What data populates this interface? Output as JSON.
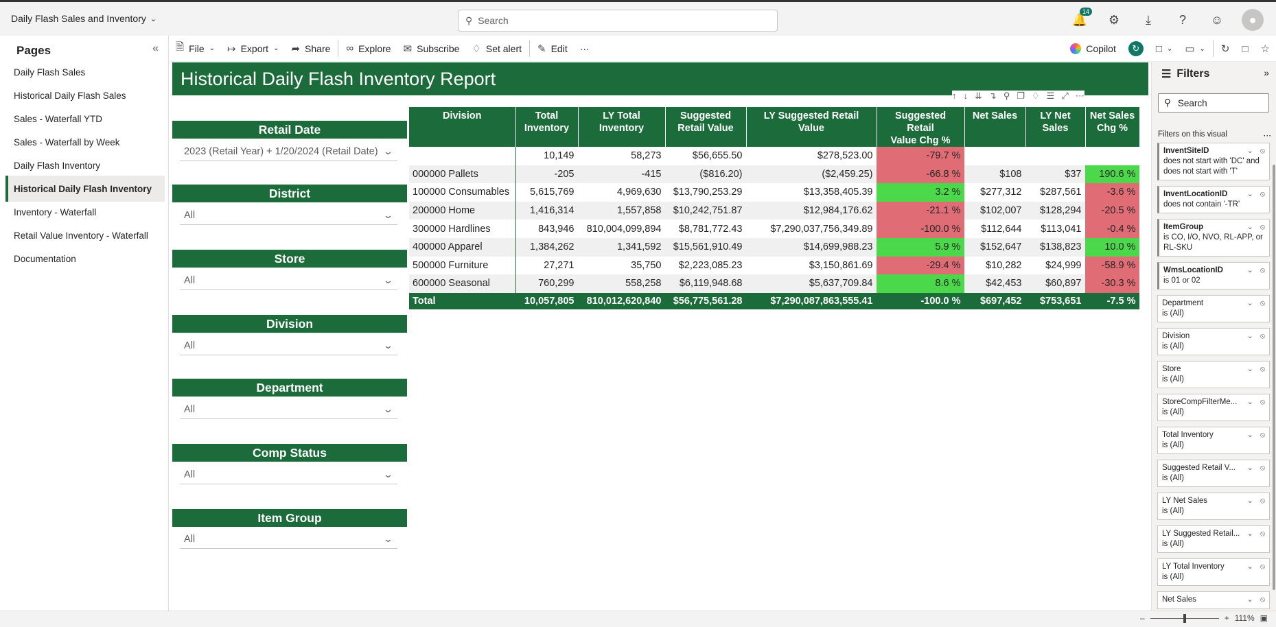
{
  "app": {
    "title": "Daily Flash Sales and Inventory",
    "search_placeholder": "Search",
    "notifications": "14"
  },
  "pages": {
    "heading": "Pages",
    "items": [
      {
        "label": "Daily Flash Sales"
      },
      {
        "label": "Historical Daily Flash Sales"
      },
      {
        "label": "Sales - Waterfall YTD"
      },
      {
        "label": "Sales - Waterfall by Week"
      },
      {
        "label": "Daily Flash Inventory"
      },
      {
        "label": "Historical Daily Flash Inventory"
      },
      {
        "label": "Inventory - Waterfall"
      },
      {
        "label": "Retail Value Inventory - Waterfall"
      },
      {
        "label": "Documentation"
      }
    ],
    "active_index": 5
  },
  "toolbar": {
    "file": "File",
    "export": "Export",
    "share": "Share",
    "explore": "Explore",
    "subscribe": "Subscribe",
    "set_alert": "Set alert",
    "edit": "Edit",
    "more": "···",
    "copilot": "Copilot"
  },
  "report": {
    "title": "Historical Daily Flash Inventory Report"
  },
  "slicers": [
    {
      "label": "Retail Date",
      "value": "2023 (Retail Year) + 1/20/2024 (Retail Date)"
    },
    {
      "label": "District",
      "value": "All"
    },
    {
      "label": "Store",
      "value": "All"
    },
    {
      "label": "Division",
      "value": "All"
    },
    {
      "label": "Department",
      "value": "All"
    },
    {
      "label": "Comp Status",
      "value": "All"
    },
    {
      "label": "Item Group",
      "value": "All"
    }
  ],
  "table": {
    "headers": [
      "Division",
      "Total\nInventory",
      "LY Total\nInventory",
      "Suggested\nRetail Value",
      "LY Suggested Retail Value",
      "Suggested Retail\nValue Chg %",
      "Net Sales",
      "LY Net\nSales",
      "Net Sales\nChg %"
    ],
    "rows": [
      [
        "",
        "10,149",
        "58,273",
        "$56,655.50",
        "$278,523.00",
        "-79.7 %",
        "",
        "",
        ""
      ],
      [
        "000000 Pallets",
        "-205",
        "-415",
        "($816.20)",
        "($2,459.25)",
        "-66.8 %",
        "$108",
        "$37",
        "190.6 %"
      ],
      [
        "100000 Consumables",
        "5,615,769",
        "4,969,630",
        "$13,790,253.29",
        "$13,358,405.39",
        "3.2 %",
        "$277,312",
        "$287,561",
        "-3.6 %"
      ],
      [
        "200000 Home",
        "1,416,314",
        "1,557,858",
        "$10,242,751.87",
        "$12,984,176.62",
        "-21.1 %",
        "$102,007",
        "$128,294",
        "-20.5 %"
      ],
      [
        "300000 Hardlines",
        "843,946",
        "810,004,099,894",
        "$8,781,772.43",
        "$7,290,037,756,349.89",
        "-100.0 %",
        "$112,644",
        "$113,041",
        "-0.4 %"
      ],
      [
        "400000 Apparel",
        "1,384,262",
        "1,341,592",
        "$15,561,910.49",
        "$14,699,988.23",
        "5.9 %",
        "$152,647",
        "$138,823",
        "10.0 %"
      ],
      [
        "500000 Furniture",
        "27,271",
        "35,750",
        "$2,223,085.23",
        "$3,150,861.69",
        "-29.4 %",
        "$10,282",
        "$24,999",
        "-58.9 %"
      ],
      [
        "600000 Seasonal",
        "760,299",
        "558,258",
        "$6,119,948.68",
        "$5,637,709.84",
        "8.6 %",
        "$42,453",
        "$60,897",
        "-30.3 %"
      ]
    ],
    "total": [
      "Total",
      "10,057,805",
      "810,012,620,840",
      "$56,775,561.28",
      "$7,290,087,863,555.41",
      "-100.0 %",
      "$697,452",
      "$753,651",
      "-7.5 %"
    ],
    "colors": {
      "negative": "#e06c75",
      "positive": "#4bd94b",
      "header": "#1c6b3a"
    }
  },
  "filters": {
    "heading": "Filters",
    "search_placeholder": "Search",
    "section": "Filters on this visual",
    "cards": [
      {
        "name": "InventSiteID",
        "value": "does not start with 'DC' and does not start with 'T'",
        "applied": true
      },
      {
        "name": "InventLocationID",
        "value": "does not contain '-TR'",
        "applied": true
      },
      {
        "name": "ItemGroup",
        "value": "is CO, I/O, NVO, RL-APP, or RL-SKU",
        "applied": true
      },
      {
        "name": "WmsLocationID",
        "value": "is 01 or 02",
        "applied": true
      },
      {
        "name": "Department",
        "value": "is (All)",
        "applied": false
      },
      {
        "name": "Division",
        "value": "is (All)",
        "applied": false
      },
      {
        "name": "Store",
        "value": "is (All)",
        "applied": false
      },
      {
        "name": "StoreCompFilterMe...",
        "value": "is (All)",
        "applied": false
      },
      {
        "name": "Total Inventory",
        "value": "is (All)",
        "applied": false
      },
      {
        "name": "Suggested Retail V...",
        "value": "is (All)",
        "applied": false
      },
      {
        "name": "LY Net Sales",
        "value": "is (All)",
        "applied": false
      },
      {
        "name": "LY Suggested Retail...",
        "value": "is (All)",
        "applied": false
      },
      {
        "name": "LY Total Inventory",
        "value": "is (All)",
        "applied": false
      },
      {
        "name": "Net Sales",
        "value": "",
        "applied": false
      }
    ]
  },
  "status": {
    "zoom": "111%"
  }
}
